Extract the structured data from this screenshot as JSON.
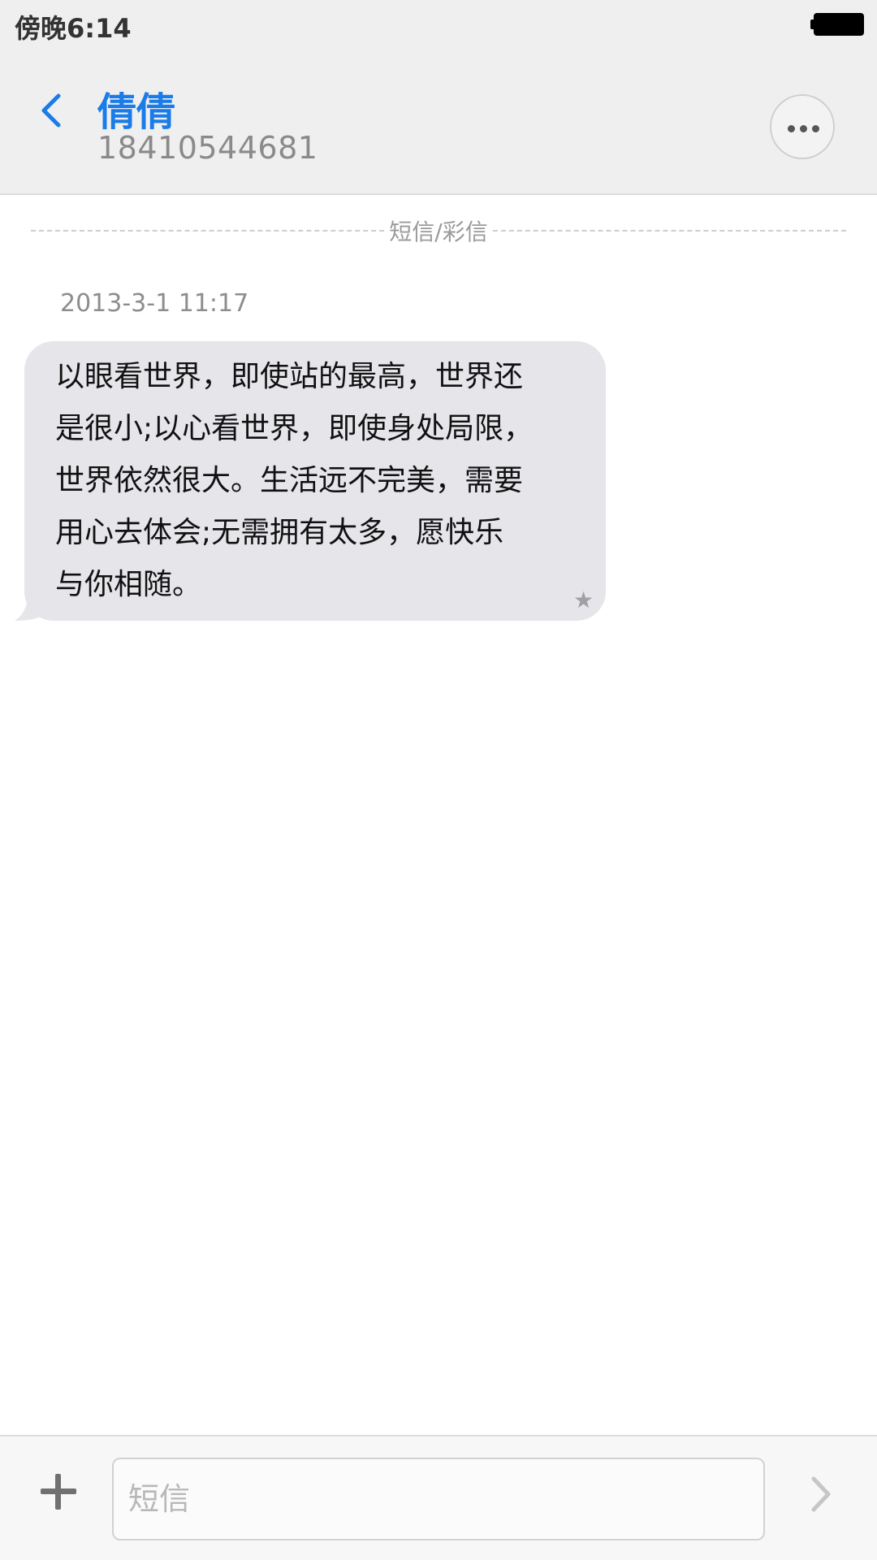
{
  "status_bar": {
    "time": "傍晚6:14"
  },
  "header": {
    "contact_name": "倩倩",
    "contact_number": "18410544681"
  },
  "conversation": {
    "type_label": "短信/彩信",
    "timestamp": "2013-3-1 11:17",
    "messages": [
      {
        "direction": "incoming",
        "lines": [
          "以眼看世界，即使站的最高，世界还",
          "是很小;以心看世界，即使身处局限，",
          "世界依然很大。生活远不完美，需要",
          "用心去体会;无需拥有太多，愿快乐",
          "与你相随。"
        ],
        "starred_icon": "star-icon"
      }
    ]
  },
  "input_bar": {
    "placeholder": "短信",
    "add_icon": "plus-icon",
    "send_icon": "chevron-right-icon"
  },
  "colors": {
    "accent": "#1a7ce8",
    "bubble": "#e5e5ea",
    "header_bg": "#efefef"
  }
}
